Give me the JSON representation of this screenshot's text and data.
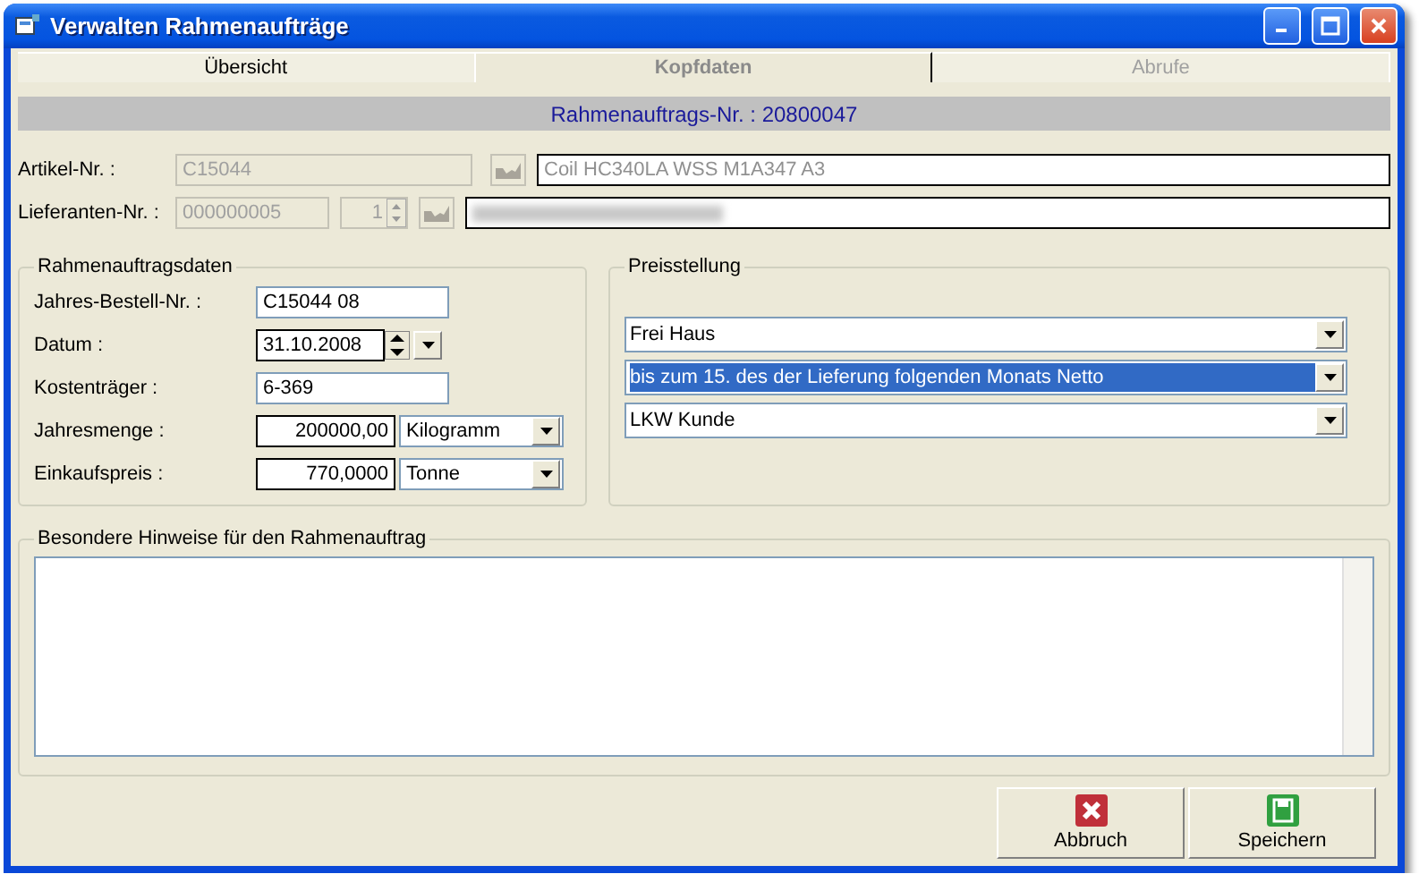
{
  "window": {
    "title": "Verwalten Rahmenaufträge"
  },
  "tabs": [
    {
      "label": "Übersicht",
      "selected": false,
      "disabled": false
    },
    {
      "label": "Kopfdaten",
      "selected": true,
      "disabled": false
    },
    {
      "label": "Abrufe",
      "selected": false,
      "disabled": true
    }
  ],
  "header": "Rahmenauftrags-Nr. : 20800047",
  "article": {
    "label": "Artikel-Nr. :",
    "value": "C15044",
    "description": "Coil HC340LA WSS M1A347 A3",
    "disabled": true
  },
  "supplier": {
    "label": "Lieferanten-Nr. :",
    "value": "000000005",
    "index": "1",
    "description_blurred": true,
    "disabled": true
  },
  "order_group": {
    "title": "Rahmenauftragsdaten",
    "rows": [
      {
        "kind": "text",
        "label": "Jahres-Bestell-Nr. :",
        "value": "C15044 08"
      },
      {
        "kind": "date",
        "label": "Datum :",
        "value": "31.10.2008"
      },
      {
        "kind": "text",
        "label": "Kostenträger :",
        "value": "6-369"
      },
      {
        "kind": "amount",
        "label": "Jahresmenge :",
        "value": "200000,00",
        "unit": "Kilogramm"
      },
      {
        "kind": "amount",
        "label": "Einkaufspreis :",
        "value": "770,0000",
        "unit": "Tonne"
      }
    ]
  },
  "pricing_group": {
    "title": "Preisstellung",
    "selects": [
      {
        "value": "Frei Haus",
        "selected": false
      },
      {
        "value": "bis zum 15. des der Lieferung folgenden Monats Netto",
        "selected": true
      },
      {
        "value": "LKW Kunde",
        "selected": false
      }
    ]
  },
  "notes_group": {
    "title": "Besondere Hinweise für den Rahmenauftrag"
  },
  "buttons": [
    {
      "kind": "cancel",
      "label": "Abbruch"
    },
    {
      "kind": "save",
      "label": "Speichern"
    }
  ]
}
